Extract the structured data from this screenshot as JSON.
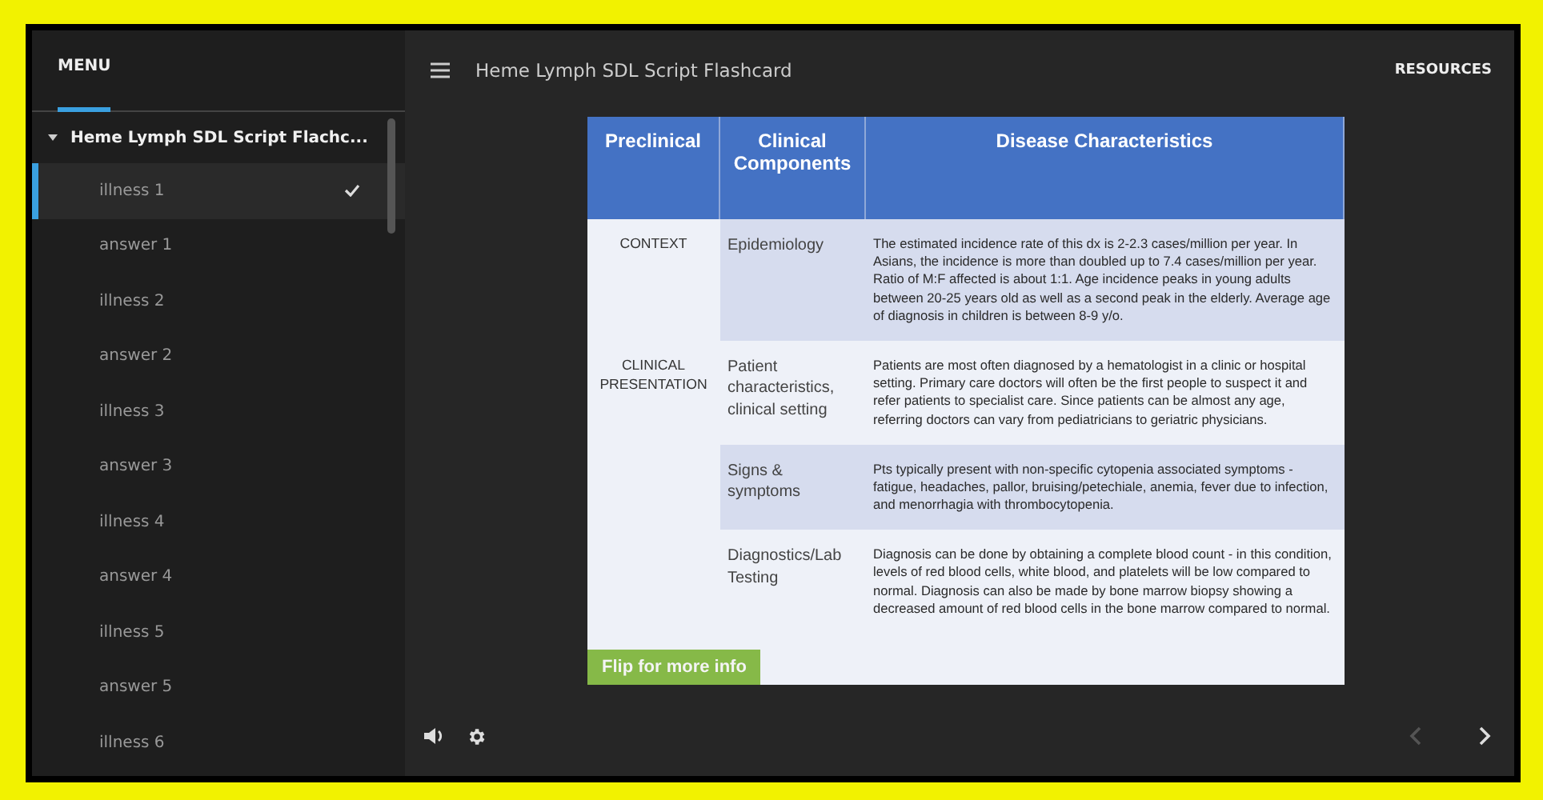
{
  "sidebar": {
    "title": "MENU",
    "group": {
      "label": "Heme Lymph SDL Script Flachc...",
      "expanded": true
    },
    "items": [
      {
        "label": "illness 1",
        "selected": true,
        "completed": true
      },
      {
        "label": "answer 1",
        "selected": false,
        "completed": false
      },
      {
        "label": "illness 2",
        "selected": false,
        "completed": false
      },
      {
        "label": "answer 2",
        "selected": false,
        "completed": false
      },
      {
        "label": "illness 3",
        "selected": false,
        "completed": false
      },
      {
        "label": "answer 3",
        "selected": false,
        "completed": false
      },
      {
        "label": "illness 4",
        "selected": false,
        "completed": false
      },
      {
        "label": "answer 4",
        "selected": false,
        "completed": false
      },
      {
        "label": "illness 5",
        "selected": false,
        "completed": false
      },
      {
        "label": "answer 5",
        "selected": false,
        "completed": false
      },
      {
        "label": "illness 6",
        "selected": false,
        "completed": false
      }
    ]
  },
  "topbar": {
    "title": "Heme Lymph SDL Script Flashcard",
    "resources": "RESOURCES"
  },
  "slide": {
    "columns": [
      "Preclinical",
      "Clinical Components",
      "Disease Characteristics"
    ],
    "rows": [
      {
        "section": "CONTEXT",
        "component": "Epidemiology",
        "text": "The estimated incidence rate of this dx is 2-2.3 cases/million per year. In Asians, the incidence is more than doubled up to 7.4 cases/million per year. Ratio of M:F affected is about 1:1. Age incidence peaks in young adults between 20-25 years old as well as a second peak in the elderly. Average age of diagnosis in children is between 8-9 y/o.",
        "shaded": true
      },
      {
        "section": "CLINICAL PRESENTATION",
        "component": "Patient characteristics, clinical setting",
        "text": "Patients are most often diagnosed by a hematologist in a clinic or hospital setting. Primary care doctors will often be the first people to suspect it and refer patients to specialist care. Since patients can be almost any age, referring doctors can vary from pediatricians to geriatric physicians.",
        "shaded": false
      },
      {
        "section": "",
        "component": "Signs & symptoms",
        "text": "Pts typically present with non-specific cytopenia associated symptoms - fatigue, headaches, pallor, bruising/petechiale, anemia, fever due to infection, and menorrhagia with thrombocytopenia.",
        "shaded": true
      },
      {
        "section": "",
        "component": "Diagnostics/Lab Testing",
        "text": "Diagnosis can be done by obtaining a  complete blood count - in this condition, levels of red blood cells, white blood, and platelets will be low compared to normal. Diagnosis can also be made by bone marrow biopsy showing a decreased amount of red blood cells in the bone marrow compared to normal.",
        "shaded": false
      }
    ],
    "flip_button": "Flip for more info"
  },
  "nav": {
    "prev_disabled": true,
    "next_disabled": false
  }
}
